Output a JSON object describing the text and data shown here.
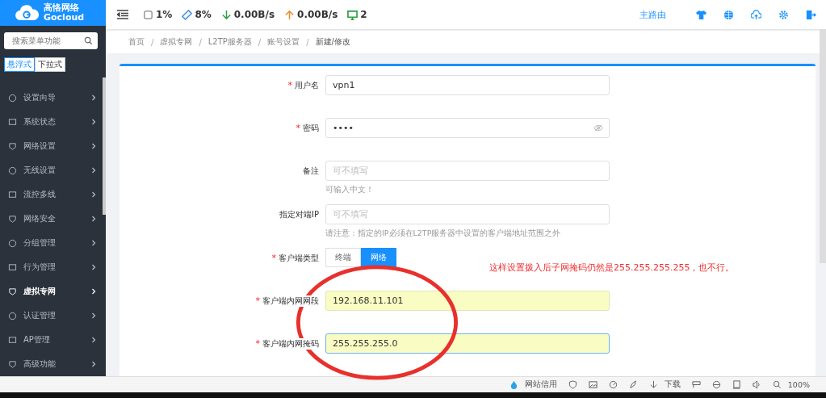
{
  "logo": {
    "cn": "高恪网络",
    "en": "Gocloud"
  },
  "header": {
    "stats": [
      {
        "kind": "cpu",
        "value": "1%"
      },
      {
        "kind": "memory",
        "value": "8%"
      },
      {
        "kind": "down",
        "value": "0.00B/s"
      },
      {
        "kind": "up",
        "value": "0.00B/s"
      },
      {
        "kind": "devices",
        "value": "2"
      }
    ],
    "route_link": "主路由"
  },
  "sidebar": {
    "search": {
      "placeholder": "搜索菜单功能"
    },
    "modes": [
      {
        "label": "悬浮式",
        "selected": true
      },
      {
        "label": "下拉式",
        "selected": false
      }
    ],
    "items": [
      {
        "label": "设置向导",
        "selected": false
      },
      {
        "label": "系统状态",
        "selected": false
      },
      {
        "label": "网络设置",
        "selected": false
      },
      {
        "label": "无线设置",
        "selected": false
      },
      {
        "label": "流控多线",
        "selected": false
      },
      {
        "label": "网络安全",
        "selected": false
      },
      {
        "label": "分组管理",
        "selected": false
      },
      {
        "label": "行为管理",
        "selected": false
      },
      {
        "label": "虚拟专网",
        "selected": true
      },
      {
        "label": "认证管理",
        "selected": false
      },
      {
        "label": "AP管理",
        "selected": false
      },
      {
        "label": "高级功能",
        "selected": false
      }
    ]
  },
  "breadcrumb": {
    "separator": "/",
    "items": [
      "首页",
      "虚拟专网",
      "L2TP服务器",
      "账号设置",
      "新建/修改"
    ]
  },
  "required_marker": "*",
  "form": [
    {
      "kind": "input",
      "label": "用户名",
      "required": true,
      "value": "vpn1"
    },
    {
      "kind": "password",
      "label": "密码",
      "required": true,
      "value": "••••"
    },
    {
      "kind": "input",
      "label": "备注",
      "required": false,
      "placeholder": "可不填写",
      "hint": "可输入中文！"
    },
    {
      "kind": "input",
      "label": "指定对端IP",
      "required": false,
      "placeholder": "可不填写",
      "hint": "请注意：指定的IP必须在L2TP服务器中设置的客户端地址范围之外"
    },
    {
      "kind": "segmented",
      "label": "客户端类型",
      "required": true,
      "options": [
        {
          "label": "终端",
          "selected": false
        },
        {
          "label": "网络",
          "selected": true
        }
      ]
    },
    {
      "kind": "input",
      "label": "客户端内网网段",
      "required": true,
      "value": "192.168.11.101",
      "highlighted": true
    },
    {
      "kind": "input",
      "label": "客户端内网掩码",
      "required": true,
      "value": "255.255.255.0",
      "highlighted": true
    }
  ],
  "annotation": "这样设置拨入后子网掩码仍然是255.255.255.255，也不行。",
  "browser_status": {
    "credit": "网站信用",
    "download": "下载",
    "zoom": "100%"
  }
}
